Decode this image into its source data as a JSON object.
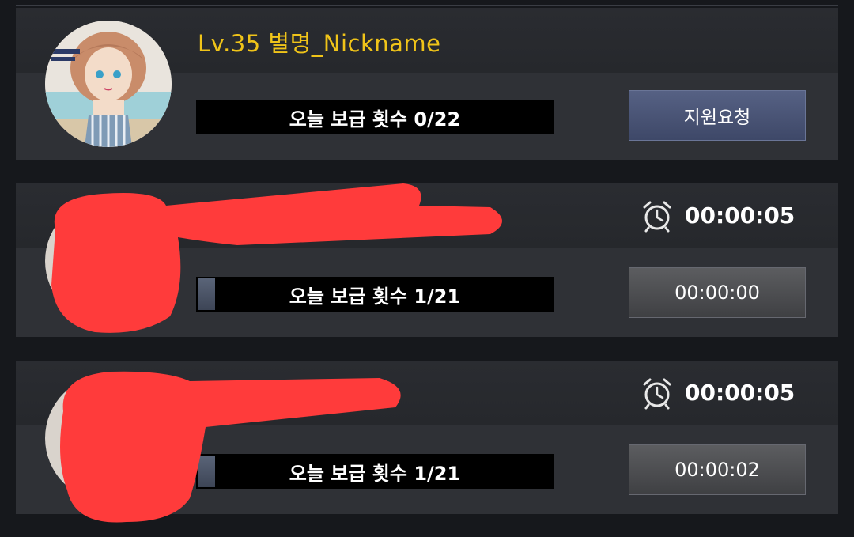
{
  "profile": {
    "level_name": "Lv.35 별명_Nickname",
    "supply_label": "오늘 보급 횟수 0/22",
    "supply_progress": 0,
    "request_button": "지원요청"
  },
  "friends": [
    {
      "name": "",
      "timer": "00:00:05",
      "supply_label": "오늘 보급 횟수 1/21",
      "supply_progress": 0.05,
      "cooldown": "00:00:00"
    },
    {
      "name": "",
      "timer": "00:00:05",
      "supply_label": "오늘 보급 횟수 1/21",
      "supply_progress": 0.05,
      "cooldown": "00:00:02"
    }
  ],
  "icons": {
    "clock": "alarm-clock-icon"
  }
}
